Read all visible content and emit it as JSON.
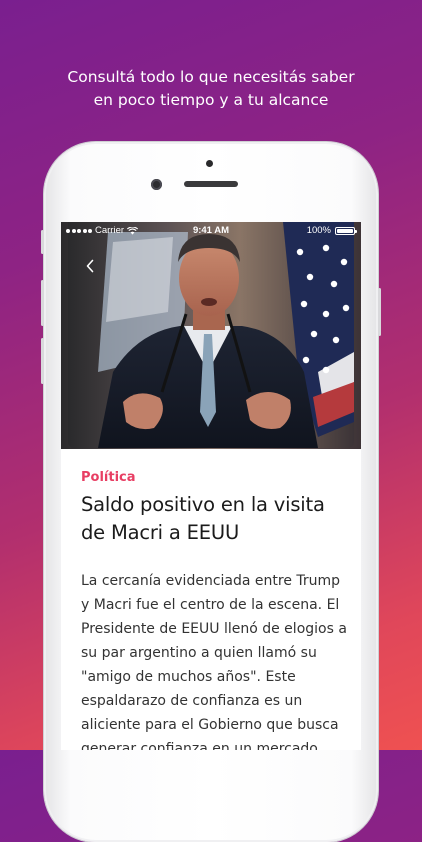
{
  "promo": {
    "line1": "Consultá todo lo que necesitás saber",
    "line2": "en poco tiempo y a tu alcance"
  },
  "status_bar": {
    "carrier": "Carrier",
    "time": "9:41 AM",
    "battery": "100%"
  },
  "article": {
    "category": "Política",
    "headline": "Saldo positivo en la visita de Macri a EEUU",
    "body": "La cercanía evidenciada entre Trump y Macri fue el centro de la escena. El Presidente de EEUU llenó de elogios a su par argentino a quien llamó su \"amigo de muchos años\". Este espaldarazo de confianza es un aliciente para el Gobierno que busca generar confianza en un mercado"
  },
  "colors": {
    "accent": "#e83e63",
    "background_top": "#7a1f8f",
    "background_bottom": "#ef5151"
  },
  "icons": {
    "back": "chevron-left-icon",
    "wifi": "wifi-icon",
    "battery": "battery-icon",
    "signal": "signal-dots-icon"
  }
}
